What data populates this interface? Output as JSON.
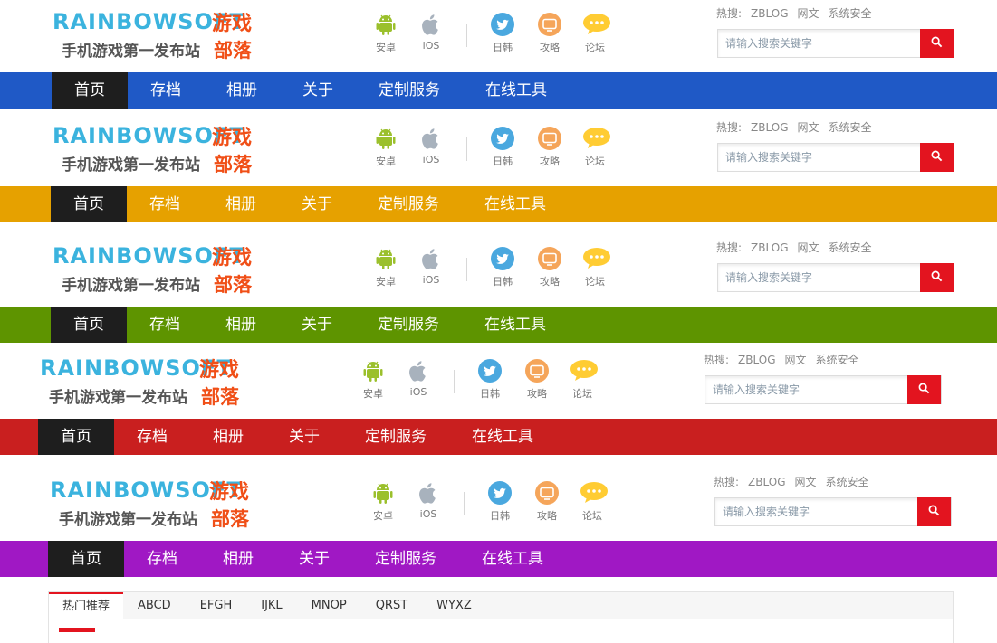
{
  "logo": {
    "brand": "RAINBOWSOFT",
    "game": "游戏",
    "subtitle": "手机游戏第一发布站",
    "tribe": "部落"
  },
  "quick_links": [
    {
      "label": "安卓",
      "icon": "android-icon"
    },
    {
      "label": "iOS",
      "icon": "apple-icon"
    },
    {
      "label": "日韩",
      "icon": "twitter-bird-icon"
    },
    {
      "label": "攻略",
      "icon": "tv-icon"
    },
    {
      "label": "论坛",
      "icon": "chat-bubble-icon"
    }
  ],
  "hot_search": {
    "label": "热搜:",
    "items": [
      "ZBLOG",
      "网文",
      "系统安全"
    ]
  },
  "search": {
    "placeholder": "请输入搜索关键字",
    "button_icon": "search-icon"
  },
  "nav": {
    "items": [
      "首页",
      "存档",
      "相册",
      "关于",
      "定制服务",
      "在线工具"
    ]
  },
  "themes": [
    {
      "name": "blue",
      "color": "#1f59c6"
    },
    {
      "name": "orange",
      "color": "#e6a100"
    },
    {
      "name": "green",
      "color": "#5e9400"
    },
    {
      "name": "red",
      "color": "#c91f1f"
    },
    {
      "name": "purple",
      "color": "#a018c4"
    }
  ],
  "colors": {
    "android_green": "#9bc02c",
    "apple_gray": "#a8b2bd",
    "twitter_blue": "#4aa8df",
    "tv_orange": "#f5a55a",
    "chat_yellow": "#ffcc33",
    "search_red": "#e3141f",
    "active_nav": "#1e1e1e"
  },
  "tabs": {
    "items": [
      "热门推荐",
      "ABCD",
      "EFGH",
      "IJKL",
      "MNOP",
      "QRST",
      "WYXZ"
    ],
    "active_index": 0
  }
}
